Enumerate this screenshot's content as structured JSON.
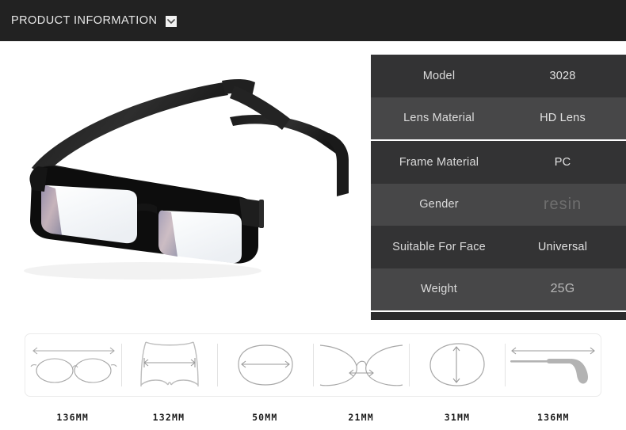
{
  "header": {
    "title": "PRODUCT INFORMATION",
    "chevron_icon": "chevron-down-icon"
  },
  "product_image": {
    "alt": "black rectangular eyeglasses frame, three-quarter angled view",
    "frame_color": "#111111",
    "lens_color": "#f2f4f7"
  },
  "spec_table": {
    "rows": [
      {
        "label": "Model",
        "value": "3028"
      },
      {
        "label": "Lens Material",
        "value": "HD Lens"
      },
      {
        "label": "Frame Material",
        "value": "PC"
      },
      {
        "label": "Gender",
        "value": "resin"
      },
      {
        "label": "Suitable For Face",
        "value": "Universal"
      },
      {
        "label": "Weight",
        "value": "25G"
      }
    ],
    "row_dark_color": "#333334",
    "row_light_color": "#474748"
  },
  "measurements": [
    {
      "label": "136MM",
      "icon": "glasses-front-width-icon",
      "caption": "total frame width"
    },
    {
      "label": "132MM",
      "icon": "glasses-top-width-icon",
      "caption": "frame inner width"
    },
    {
      "label": "50MM",
      "icon": "lens-width-icon",
      "caption": "lens width"
    },
    {
      "label": "21MM",
      "icon": "bridge-width-icon",
      "caption": "bridge width"
    },
    {
      "label": "31MM",
      "icon": "lens-height-icon",
      "caption": "lens height"
    },
    {
      "label": "136MM",
      "icon": "temple-arm-length-icon",
      "caption": "temple length"
    }
  ]
}
